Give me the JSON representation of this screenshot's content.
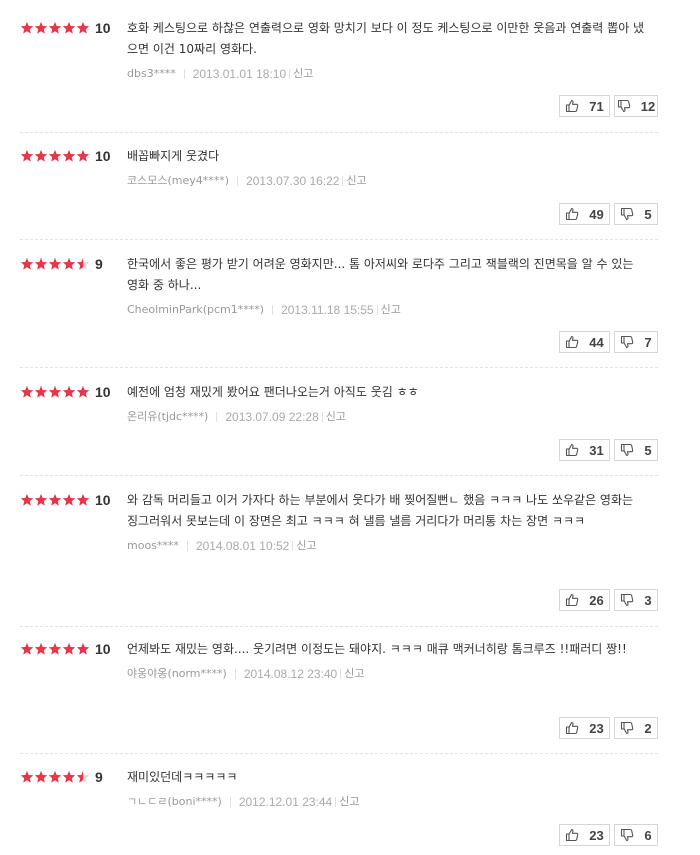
{
  "report_label": "신고",
  "reviews": [
    {
      "stars": 5,
      "score": "10",
      "text": "호화 케스팅으로 하찮은 연출력으로 영화 망치기 보다 이 정도 케스팅으로 이만한 웃음과 연출력 뽑아 냈으면 이건 10짜리 영화다.",
      "author": "dbs3****",
      "date": "2013.01.01 18:10",
      "likes": "71",
      "dislikes": "12"
    },
    {
      "stars": 5,
      "score": "10",
      "text": "배꼽빠지게 웃겼다",
      "author": "코스모스(mey4****)",
      "date": "2013.07.30 16:22",
      "likes": "49",
      "dislikes": "5"
    },
    {
      "stars": 4.5,
      "score": "9",
      "text": "한국에서 좋은 평가 받기 어려운 영화지만... 톰 아저씨와 로다주 그리고 잭블랙의 진면목을 알 수 있는 영화 중 하나...",
      "author": "CheolminPark(pcm1****)",
      "date": "2013.11.18 15:55",
      "likes": "44",
      "dislikes": "7"
    },
    {
      "stars": 5,
      "score": "10",
      "text": "예전에 엄청 재밌게 봤어요 팬더나오는거 아직도 웃김 ㅎㅎ",
      "author": "온리유(tjdc****)",
      "date": "2013.07.09 22:28",
      "likes": "31",
      "dislikes": "5"
    },
    {
      "stars": 5,
      "score": "10",
      "text": "와 감독 머리들고 이거 가자다 하는 부분에서 웃다가 배 찢어질뻔ㄴ 했음 ㅋㅋㅋ 나도 쏘우같은 영화는 징그러워서 못보는데 이 장면은 최고 ㅋㅋㅋ 혀 낼름 낼름 거리다가 머리통 차는 장면 ㅋㅋㅋ",
      "author": "moos****",
      "date": "2014.08.01 10:52",
      "likes": "26",
      "dislikes": "3"
    },
    {
      "stars": 5,
      "score": "10",
      "text": "언제봐도 재밌는 영화.... 웃기려면 이정도는 돼야지. ㅋㅋㅋ 매큐 맥커너히랑 톰크루즈 !!패러디 짱!!",
      "author": "야옹야옹(norm****)",
      "date": "2014.08.12 23:40",
      "likes": "23",
      "dislikes": "2"
    },
    {
      "stars": 4.5,
      "score": "9",
      "text": "재미있던데ㅋㅋㅋㅋㅋ",
      "author": "ㄱㄴㄷㄹ(boni****)",
      "date": "2012.12.01 23:44",
      "likes": "23",
      "dislikes": "6"
    }
  ],
  "colors": {
    "star_full": "#e8354a",
    "star_empty": "#d9d9d9"
  },
  "icons": {
    "like": "thumbs-up-icon",
    "dislike": "thumbs-down-icon"
  }
}
